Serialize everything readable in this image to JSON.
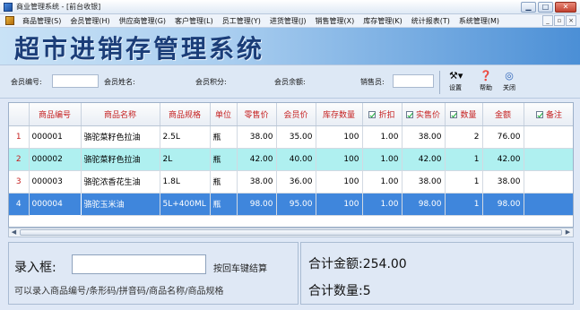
{
  "window": {
    "title": "商业管理系统 - [前台收银]",
    "controls": [
      "minimize",
      "maximize",
      "close"
    ]
  },
  "menubar": {
    "items": [
      "商品管理(S)",
      "会员管理(H)",
      "供应商管理(G)",
      "客户管理(L)",
      "员工管理(Y)",
      "进货管理(J)",
      "销售管理(X)",
      "库存管理(K)",
      "统计报表(T)",
      "系统管理(M)"
    ],
    "mdi_controls": [
      "_",
      "▫",
      "×"
    ]
  },
  "banner": {
    "title": "超市进销存管理系统"
  },
  "infobar": {
    "member_id_label": "会员编号:",
    "member_name_label": "会员姓名:",
    "member_points_label": "会员积分:",
    "member_balance_label": "会员余额:",
    "salesperson_label": "销售员:",
    "settings_label": "设置",
    "help_label": "帮助",
    "close_label": "关闭"
  },
  "grid": {
    "columns": [
      "",
      "商品编号",
      "商品名称",
      "商品规格",
      "单位",
      "零售价",
      "会员价",
      "库存数量",
      "折扣",
      "实售价",
      "数量",
      "金额",
      "备注"
    ],
    "rows": [
      {
        "no": "1",
        "code": "000001",
        "name": "骆驼菜籽色拉油",
        "spec": "2.5L",
        "unit": "瓶",
        "retail": "38.00",
        "member": "35.00",
        "stock": "100",
        "discount": "1.00",
        "actual": "38.00",
        "qty": "2",
        "amount": "76.00",
        "note": ""
      },
      {
        "no": "2",
        "code": "000002",
        "name": "骆驼菜籽色拉油",
        "spec": "2L",
        "unit": "瓶",
        "retail": "42.00",
        "member": "40.00",
        "stock": "100",
        "discount": "1.00",
        "actual": "42.00",
        "qty": "1",
        "amount": "42.00",
        "note": ""
      },
      {
        "no": "3",
        "code": "000003",
        "name": "骆驼浓香花生油",
        "spec": "1.8L",
        "unit": "瓶",
        "retail": "38.00",
        "member": "36.00",
        "stock": "100",
        "discount": "1.00",
        "actual": "38.00",
        "qty": "1",
        "amount": "38.00",
        "note": ""
      },
      {
        "no": "4",
        "code": "000004",
        "name": "骆驼玉米油",
        "spec": "5L+400ML",
        "unit": "瓶",
        "retail": "98.00",
        "member": "95.00",
        "stock": "100",
        "discount": "1.00",
        "actual": "98.00",
        "qty": "1",
        "amount": "98.00",
        "note": ""
      }
    ]
  },
  "entry": {
    "label": "录入框:",
    "value": "",
    "hint": "按回车键结算",
    "tip": "可以录入商品编号/条形码/拼音码/商品名称/商品规格"
  },
  "totals": {
    "amount_label": "合计金额:",
    "amount_value": "254.00",
    "qty_label": "合计数量:",
    "qty_value": "5"
  },
  "colors": {
    "selected_row": "#3f86dc",
    "alt_row": "#aff0f0",
    "header_text": "#c51f1f",
    "banner_text": "#1b3d78"
  }
}
